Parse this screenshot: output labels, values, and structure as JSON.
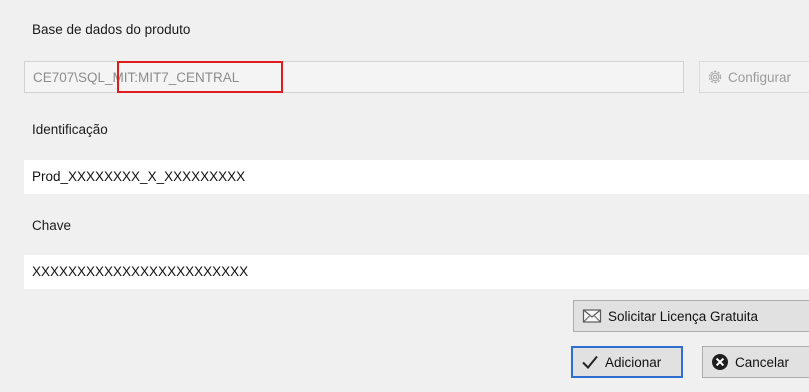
{
  "database": {
    "label": "Base de dados do produto",
    "value": "CE707\\SQL_MIT:MIT7_CENTRAL",
    "configure_label": "Configurar"
  },
  "identification": {
    "label": "Identificação",
    "value": "Prod_XXXXXXXX_X_XXXXXXXXX"
  },
  "key": {
    "label": "Chave",
    "value": "XXXXXXXXXXXXXXXXXXXXXXXX"
  },
  "buttons": {
    "request_license": "Solicitar Licença Gratuita",
    "add": "Adicionar",
    "cancel": "Cancelar"
  },
  "colors": {
    "highlight": "#e01b1b",
    "default_button_border": "#2f6fd1"
  }
}
